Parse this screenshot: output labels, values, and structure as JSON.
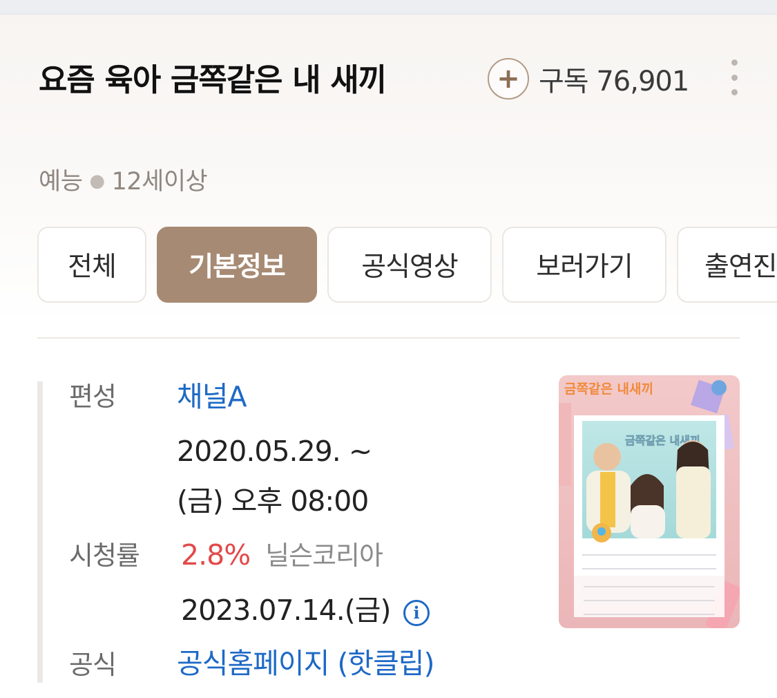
{
  "program": {
    "title": "요즘 육아 금쪽같은 내 새끼",
    "genre": "예능",
    "rating": "12세이상"
  },
  "subscribe": {
    "label": "구독",
    "count": "76,901",
    "icon": "plus-icon"
  },
  "tabs": [
    {
      "label": "전체",
      "active": false
    },
    {
      "label": "기본정보",
      "active": true
    },
    {
      "label": "공식영상",
      "active": false
    },
    {
      "label": "보러가기",
      "active": false
    },
    {
      "label": "출연진",
      "active": false
    }
  ],
  "info": {
    "broadcast": {
      "label": "편성",
      "channel": "채널A",
      "period": "2020.05.29. ~",
      "schedule": "(금) 오후 08:00"
    },
    "ratings": {
      "label": "시청률",
      "value": "2.8%",
      "source": "닐슨코리아",
      "date": "2023.07.14.(금)"
    },
    "official": {
      "label": "공식",
      "homepage": "공식홈페이지",
      "clip": "(핫클립)"
    }
  },
  "poster": {
    "text_top": "금쪽같은 내새끼",
    "text_center": "금쪽같은 내새끼"
  },
  "colors": {
    "accent": "#a78a73",
    "link": "#1e69c6",
    "rating_value": "#e24a4a"
  }
}
